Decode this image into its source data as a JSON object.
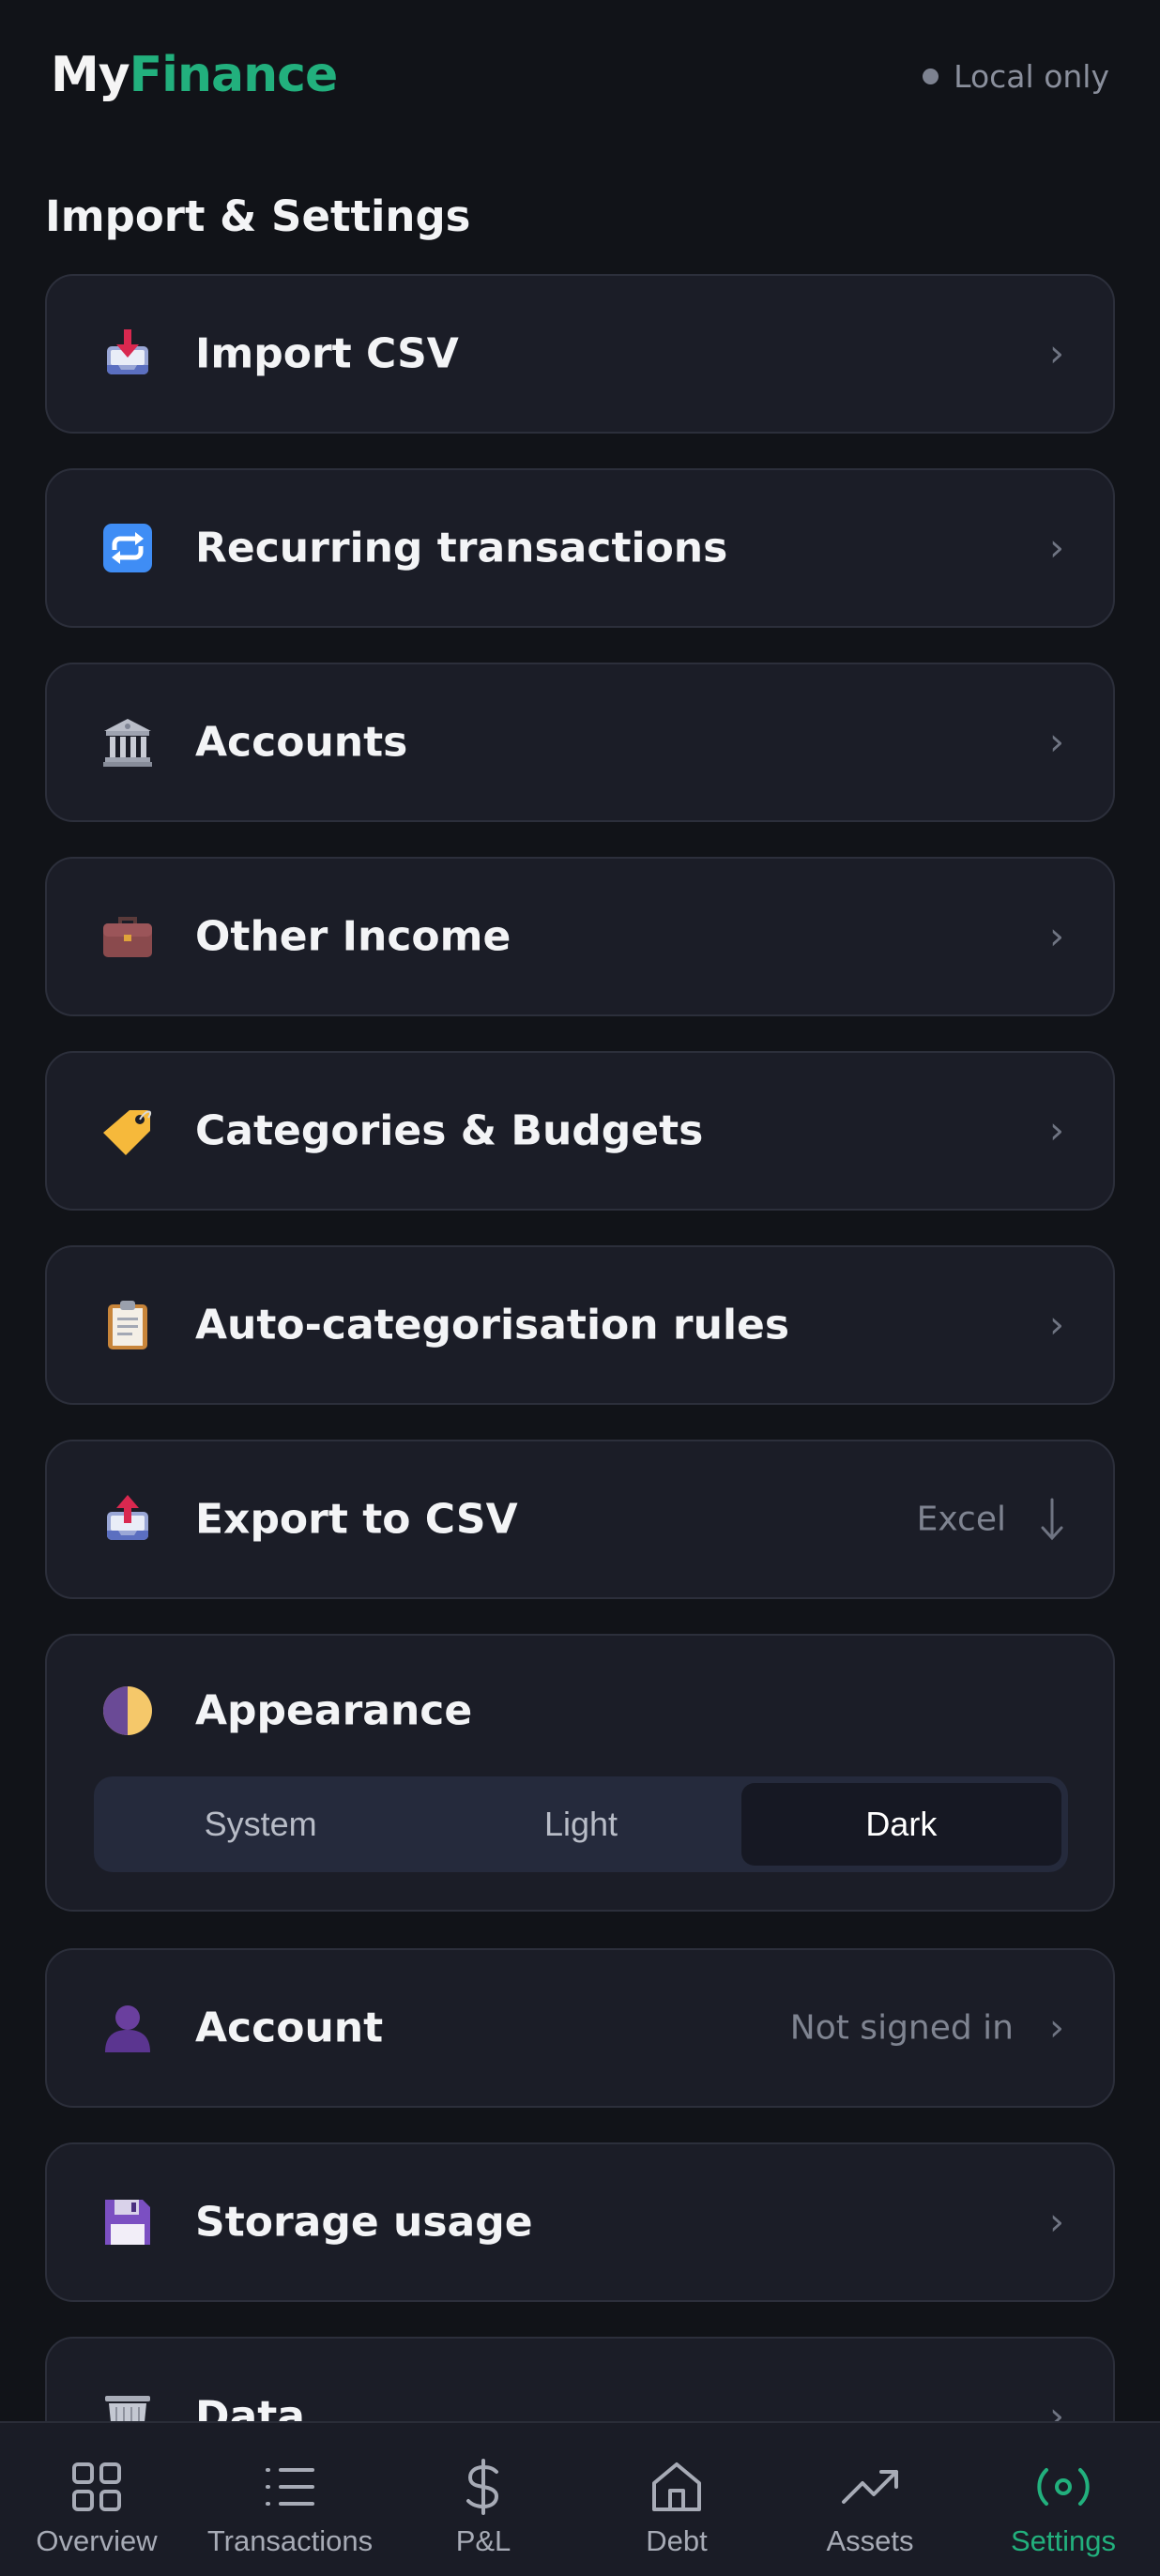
{
  "brand": {
    "part1": "My",
    "part2": "Finance"
  },
  "status": {
    "text": "Local only"
  },
  "page_title": "Import & Settings",
  "items": [
    {
      "label": "Import CSV",
      "icon": "inbox-tray-icon"
    },
    {
      "label": "Recurring transactions",
      "icon": "repeat-icon"
    },
    {
      "label": "Accounts",
      "icon": "bank-icon"
    },
    {
      "label": "Other Income",
      "icon": "briefcase-icon"
    },
    {
      "label": "Categories & Budgets",
      "icon": "label-tag-icon"
    },
    {
      "label": "Auto-categorisation rules",
      "icon": "clipboard-icon"
    },
    {
      "label": "Export to CSV",
      "icon": "outbox-tray-icon",
      "meta": "Excel"
    }
  ],
  "appearance": {
    "label": "Appearance",
    "icon": "half-moon-icon",
    "options": [
      "System",
      "Light",
      "Dark"
    ],
    "selected": "Dark"
  },
  "account": {
    "label": "Account",
    "meta": "Not signed in",
    "icon": "user-silhouette-icon"
  },
  "storage": {
    "label": "Storage usage",
    "icon": "floppy-disk-icon"
  },
  "data": {
    "label": "Data",
    "icon": "wastebasket-icon"
  },
  "chevron": "›",
  "tabs": [
    {
      "label": "Overview",
      "icon": "grid-icon"
    },
    {
      "label": "Transactions",
      "icon": "list-icon"
    },
    {
      "label": "P&L",
      "icon": "dollar-icon"
    },
    {
      "label": "Debt",
      "icon": "home-icon"
    },
    {
      "label": "Assets",
      "icon": "trending-up-icon"
    },
    {
      "label": "Settings",
      "icon": "settings-icon",
      "active": true
    }
  ],
  "colors": {
    "accent": "#22b07d",
    "background": "#111318",
    "card": "#1b1d27"
  }
}
